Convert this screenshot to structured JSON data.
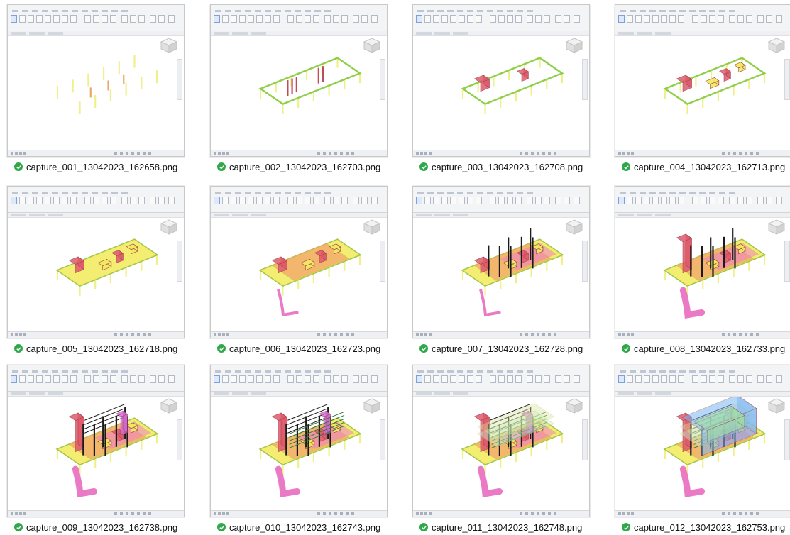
{
  "view": "thumbnail-grid",
  "status_icon": "green-check-icon",
  "files": [
    {
      "name": "capture_001_13042023_162658.png",
      "stage": 1
    },
    {
      "name": "capture_002_13042023_162703.png",
      "stage": 2
    },
    {
      "name": "capture_003_13042023_162708.png",
      "stage": 3
    },
    {
      "name": "capture_004_13042023_162713.png",
      "stage": 4
    },
    {
      "name": "capture_005_13042023_162718.png",
      "stage": 5
    },
    {
      "name": "capture_006_13042023_162723.png",
      "stage": 6
    },
    {
      "name": "capture_007_13042023_162728.png",
      "stage": 7
    },
    {
      "name": "capture_008_13042023_162733.png",
      "stage": 8
    },
    {
      "name": "capture_009_13042023_162738.png",
      "stage": 9
    },
    {
      "name": "capture_010_13042023_162743.png",
      "stage": 10
    },
    {
      "name": "capture_011_13042023_162748.png",
      "stage": 11
    },
    {
      "name": "capture_012_13042023_162753.png",
      "stage": 12
    }
  ],
  "colors": {
    "check_green": "#2fa84a",
    "column_yellow": "#f0f08a",
    "beam_green": "#8fcf4a",
    "slab_yellow": "#f3ee72",
    "core_red": "#e05a6a",
    "ramp_pink": "#e96bc0",
    "slab_orange": "#f2a46a",
    "steel_black": "#1b1b1b",
    "upper_blue": "#7db7f0",
    "upper_green": "#9fe0a0"
  }
}
